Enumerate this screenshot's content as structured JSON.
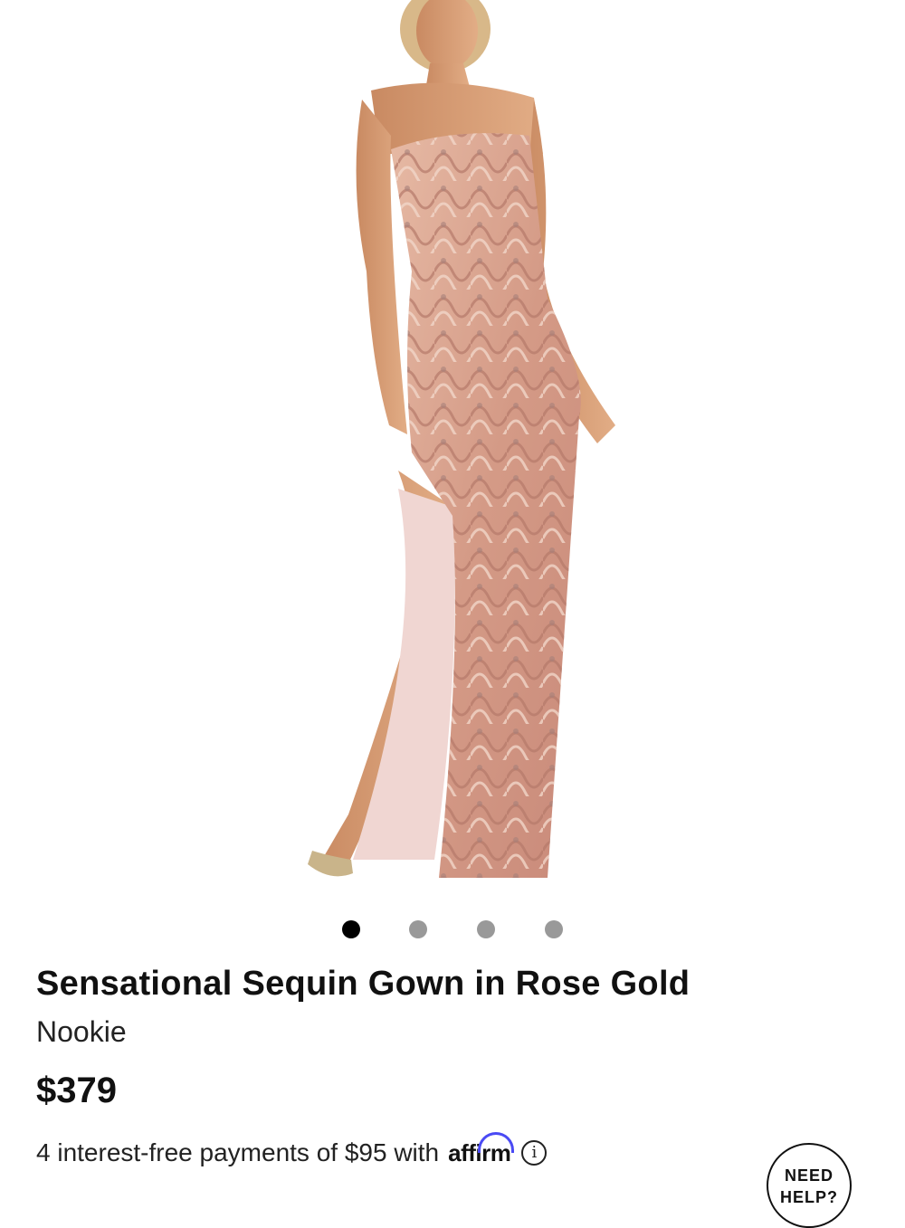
{
  "product": {
    "image_alt": "Model wearing rose gold strapless sequin gown",
    "gallery": {
      "total": 4,
      "active_index": 0
    },
    "title": "Sensational Sequin Gown in Rose Gold",
    "brand": "Nookie",
    "price": "$379",
    "installment_text": "4 interest-free payments of $95 with",
    "affirm_label": "affirm",
    "info_icon": "i"
  },
  "help": {
    "line1": "NEED",
    "line2": "HELP?"
  },
  "colors": {
    "dot_active": "#000000",
    "dot_inactive": "#999999",
    "affirm_arc": "#4a4af4",
    "dress": "#d9a08c"
  }
}
